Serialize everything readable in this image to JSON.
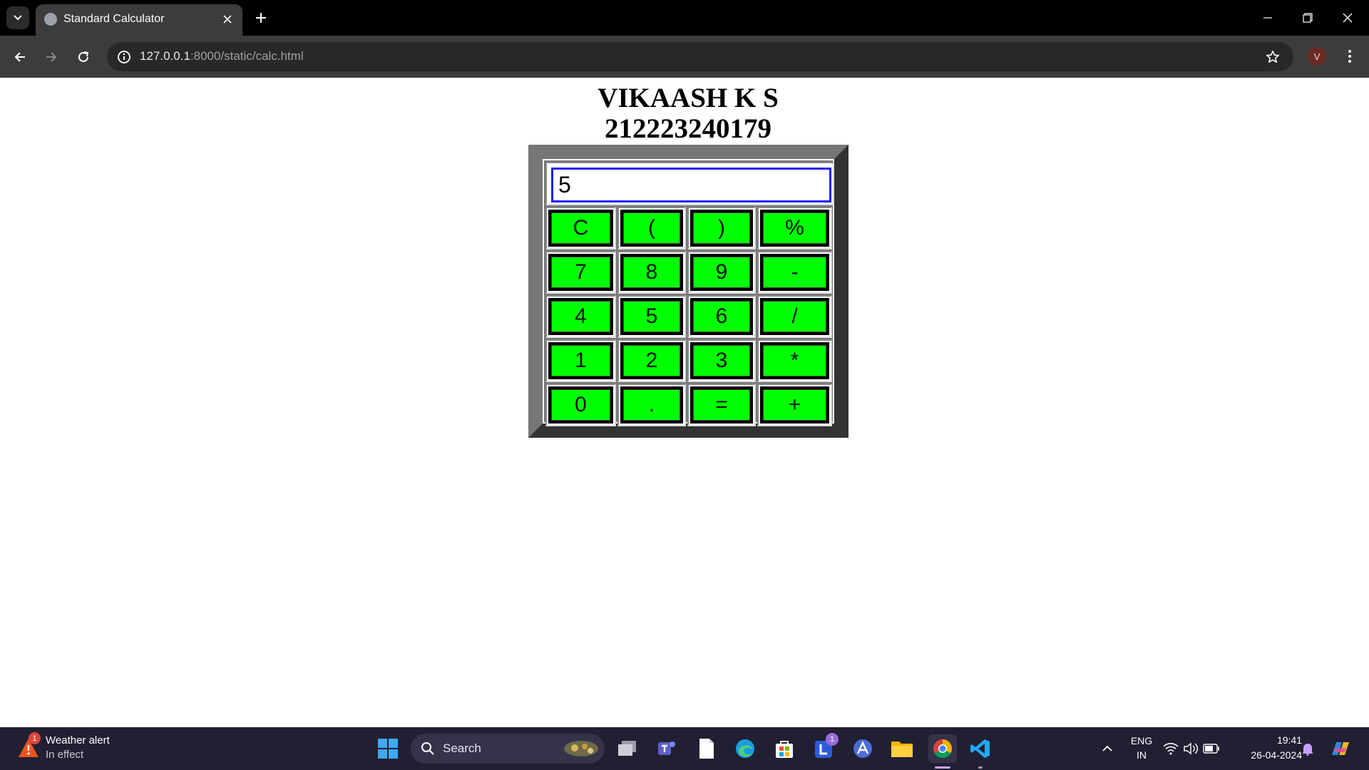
{
  "browser": {
    "tab_title": "Standard Calculator",
    "url_host": "127.0.0.1",
    "url_path": ":8000/static/calc.html",
    "profile_initial": "V"
  },
  "page": {
    "name": "VIKAASH K S",
    "register_number": "212223240179"
  },
  "calculator": {
    "display_value": "5",
    "keys": [
      [
        "C",
        "(",
        ")",
        "%"
      ],
      [
        "7",
        "8",
        "9",
        "-"
      ],
      [
        "4",
        "5",
        "6",
        "/"
      ],
      [
        "1",
        "2",
        "3",
        "*"
      ],
      [
        "0",
        ".",
        "=",
        "+"
      ]
    ],
    "key_color": "#00ff00",
    "display_border_color": "#1a1aff"
  },
  "taskbar": {
    "weather_title": "Weather alert",
    "weather_subtitle": "In effect",
    "weather_badge": "1",
    "search_label": "Search",
    "lexicon_badge": "1",
    "lang_top": "ENG",
    "lang_bottom": "IN",
    "time": "19:41",
    "date": "26-04-2024"
  }
}
